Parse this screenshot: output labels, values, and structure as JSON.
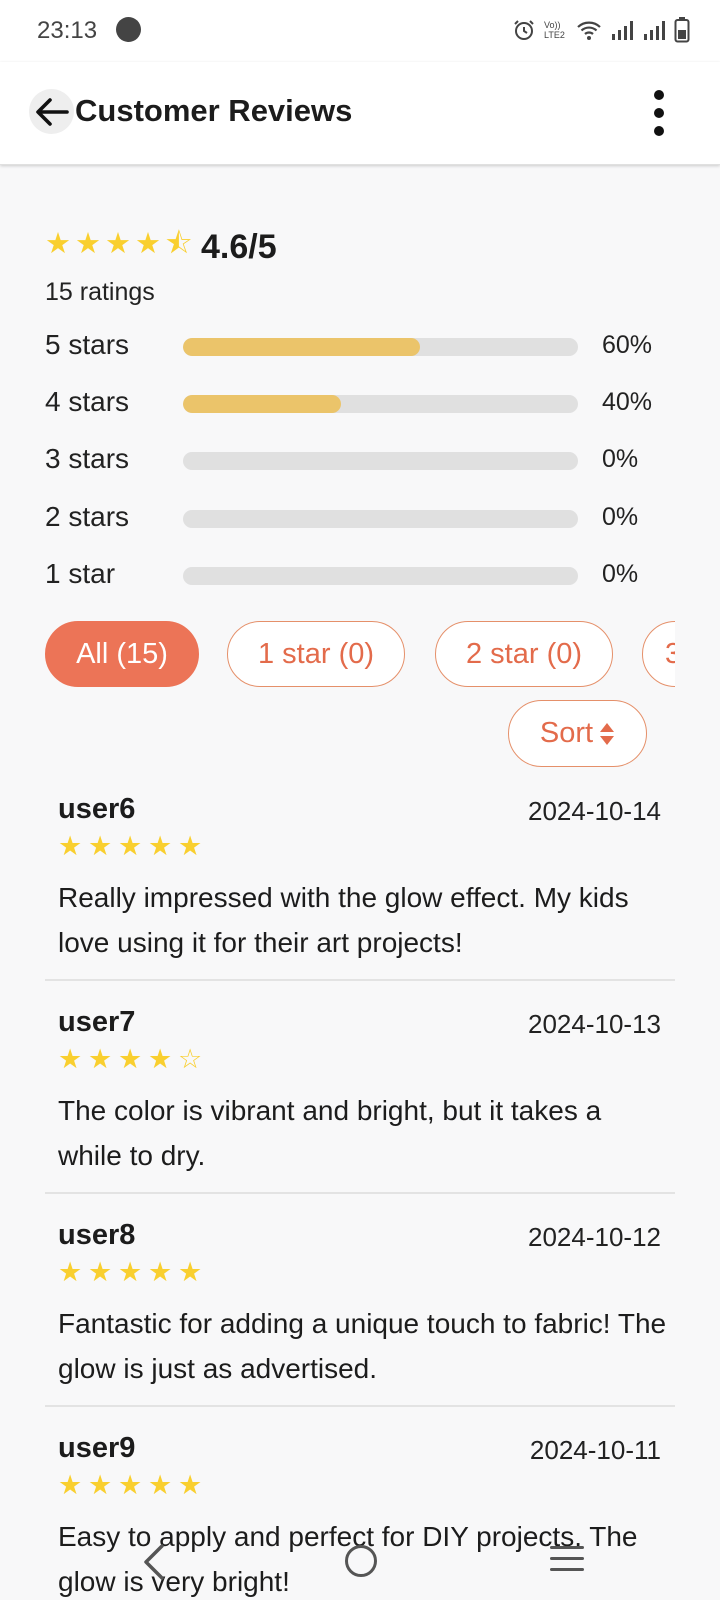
{
  "status_bar": {
    "time": "23:13",
    "network_label": "Vo)) LTE2"
  },
  "header": {
    "title": "Customer Reviews"
  },
  "summary": {
    "score_label": "4.6/5",
    "stars": [
      "★",
      "★",
      "★",
      "★",
      "⯪"
    ],
    "ratings_count": "15 ratings",
    "distribution": [
      {
        "label": "5 stars",
        "percent_label": "60%",
        "percent": 60
      },
      {
        "label": "4 stars",
        "percent_label": "40%",
        "percent": 40
      },
      {
        "label": "3 stars",
        "percent_label": "0%",
        "percent": 0
      },
      {
        "label": "2 stars",
        "percent_label": "0%",
        "percent": 0
      },
      {
        "label": "1 star",
        "percent_label": "0%",
        "percent": 0
      }
    ],
    "bar_color": "#ebc46a"
  },
  "filters": {
    "chips": [
      {
        "label": "All (15)",
        "active": true
      },
      {
        "label": "1 star (0)",
        "active": false
      },
      {
        "label": "2 star (0)",
        "active": false
      },
      {
        "label": "3",
        "active": false
      }
    ],
    "sort_label": "Sort",
    "accent_color": "#ec7457"
  },
  "reviews": [
    {
      "user": "user6",
      "date": "2024-10-14",
      "rating": 5,
      "stars": [
        "★",
        "★",
        "★",
        "★",
        "★"
      ],
      "text": "Really impressed with the glow effect. My kids love using it for their art projects!"
    },
    {
      "user": "user7",
      "date": "2024-10-13",
      "rating": 4,
      "stars": [
        "★",
        "★",
        "★",
        "★",
        "☆"
      ],
      "text": "The color is vibrant and bright, but it takes a while to dry."
    },
    {
      "user": "user8",
      "date": "2024-10-12",
      "rating": 5,
      "stars": [
        "★",
        "★",
        "★",
        "★",
        "★"
      ],
      "text": "Fantastic for adding a unique touch to fabric! The glow is just as advertised."
    },
    {
      "user": "user9",
      "date": "2024-10-11",
      "rating": 5,
      "stars": [
        "★",
        "★",
        "★",
        "★",
        "★"
      ],
      "text": "Easy to apply and perfect for DIY projects. The glow is very bright!"
    }
  ],
  "icons": {
    "back": "arrow-left-icon",
    "more": "more-vertical-icon",
    "sort": "sort-updown-icon",
    "star_color": "#f9cf2f"
  }
}
